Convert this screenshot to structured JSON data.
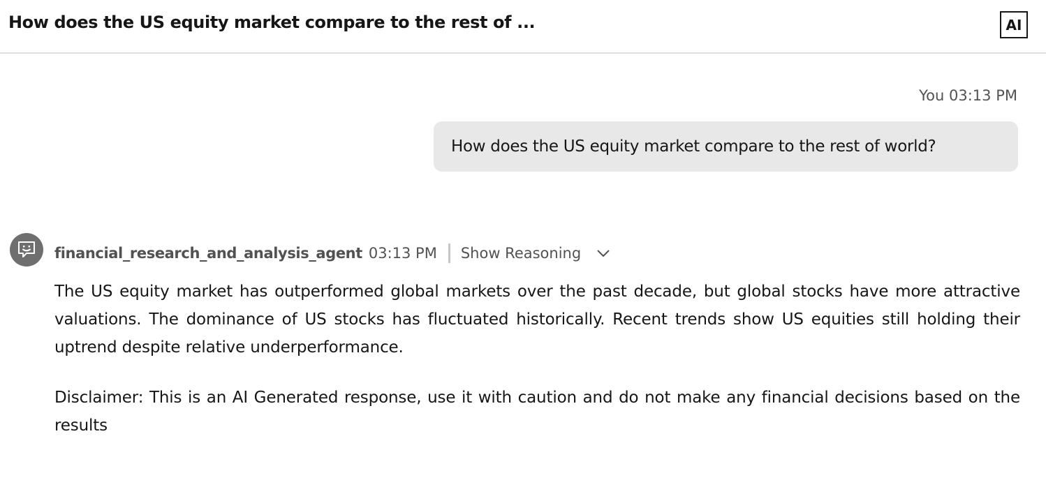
{
  "header": {
    "title": "How does the US equity market compare to the rest of ...",
    "ai_badge_label": "AI"
  },
  "user_message": {
    "meta": "You 03:13 PM",
    "text": "How does the US equity market compare to the rest of world?"
  },
  "agent_message": {
    "avatar_icon": "chat-bot-icon",
    "agent_name": "financial_research_and_analysis_agent",
    "time": "03:13 PM",
    "show_reasoning_label": "Show Reasoning",
    "response": "The US equity market has outperformed global markets over the past decade, but global stocks have more attractive valuations. The dominance of US stocks has fluctuated historically. Recent trends show US equities still holding their uptrend despite relative underperformance.",
    "disclaimer": "Disclaimer: This is an AI Generated response, use it with caution and do not make any financial decisions based on the results"
  },
  "colors": {
    "text_primary": "#161616",
    "text_secondary": "#525252",
    "bubble_bg": "#e8e8e8",
    "avatar_bg": "#6f6f6f",
    "divider": "#c6c6c6"
  }
}
